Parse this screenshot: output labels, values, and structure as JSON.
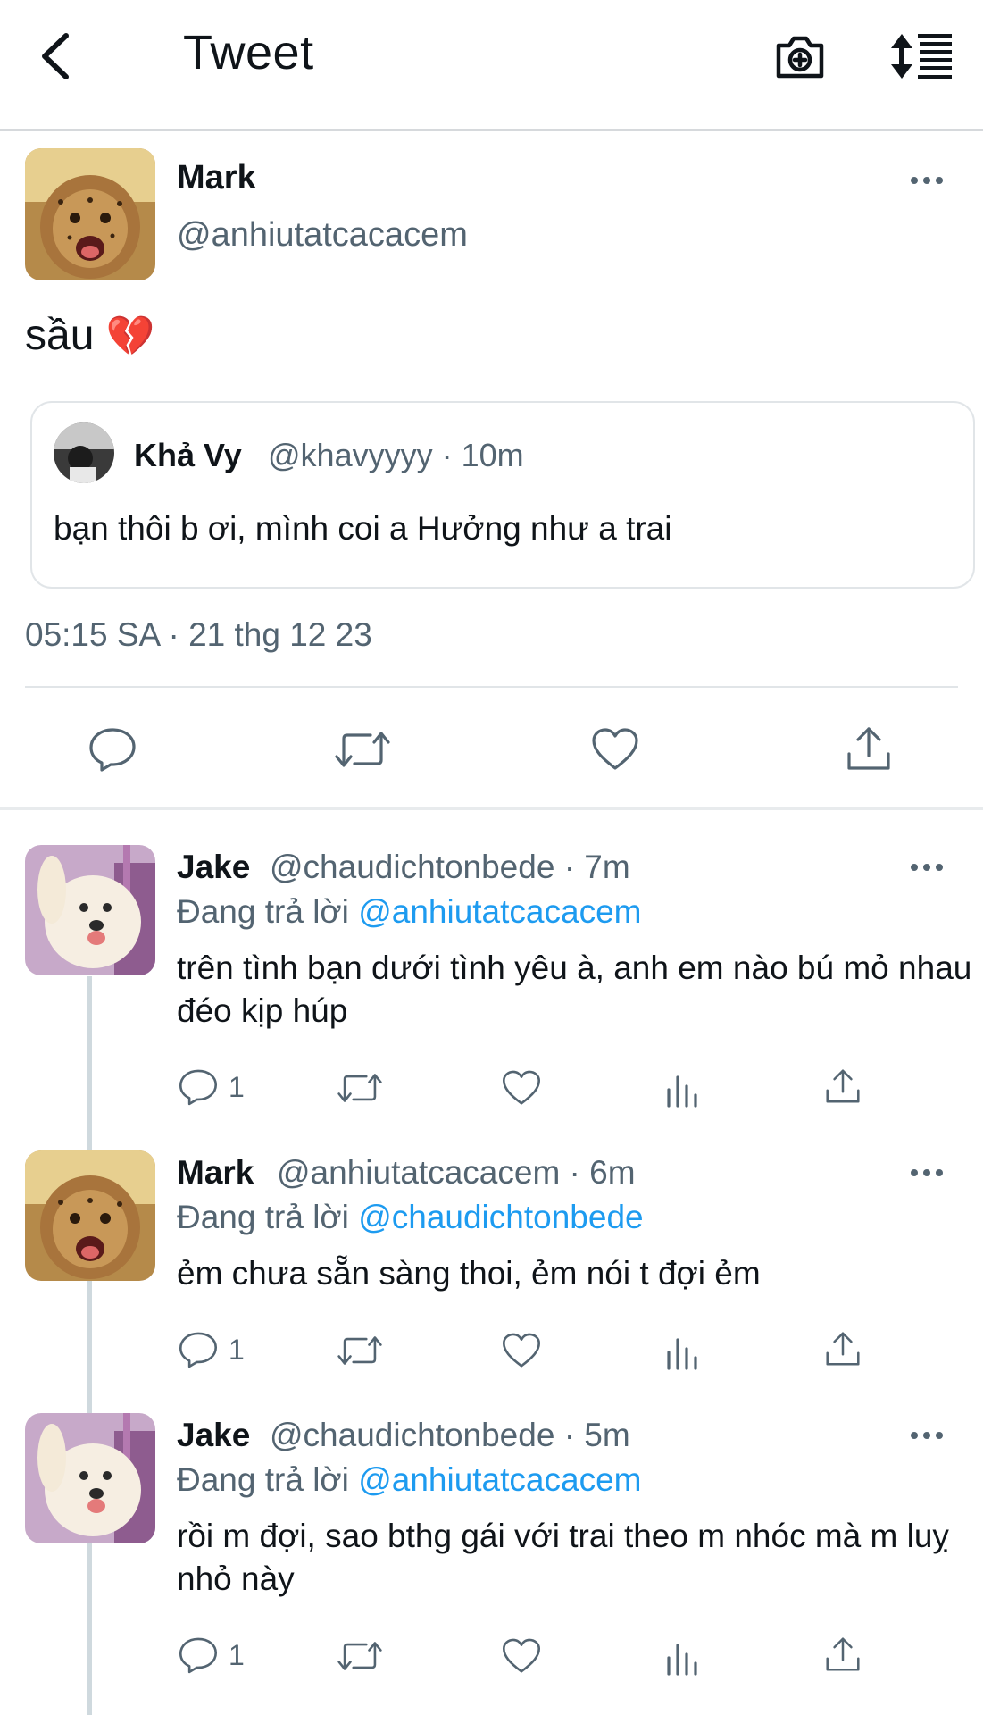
{
  "header": {
    "title": "Tweet"
  },
  "tweet": {
    "name": "Mark",
    "handle": "@anhiutatcacacem",
    "text": "sầu",
    "emoji": "💔",
    "quote": {
      "name": "Khả Vy",
      "meta": "@khavyyyy · 10m",
      "text": "bạn thôi b ơi, mình coi a Hưởng như a trai"
    },
    "timestamp": "05:15 SA · 21 thg 12 23"
  },
  "replies": [
    {
      "name": "Jake",
      "meta": "@chaudichtonbede · 7m",
      "replying_prefix": "Đang trả lời",
      "replying_to": "@anhiutatcacacem",
      "text": "trên tình bạn dưới tình yêu à, anh em nào bú mỏ nhau đéo kịp húp",
      "reply_count": "1"
    },
    {
      "name": "Mark",
      "meta": "@anhiutatcacacem · 6m",
      "replying_prefix": "Đang trả lời",
      "replying_to": "@chaudichtonbede",
      "text": "ẻm chưa sẵn sàng thoi, ẻm nói t đợi ẻm",
      "reply_count": "1"
    },
    {
      "name": "Jake",
      "meta": "@chaudichtonbede · 5m",
      "replying_prefix": "Đang trả lời",
      "replying_to": "@anhiutatcacacem",
      "text": "rồi m đợi, sao bthg gái với trai theo m nhóc mà m luỵ nhỏ này",
      "reply_count": "1"
    }
  ],
  "icons": {
    "back": "chevron-left-icon",
    "camera": "camera-plus-icon",
    "sort": "sort-icon",
    "reply": "comment-icon",
    "retweet": "retweet-icon",
    "like": "heart-icon",
    "views": "analytics-icon",
    "share": "share-icon",
    "more": "more-icon"
  },
  "colors": {
    "link": "#1d9bf0",
    "secondary": "#536471",
    "heart_emoji": "#e0245e"
  }
}
